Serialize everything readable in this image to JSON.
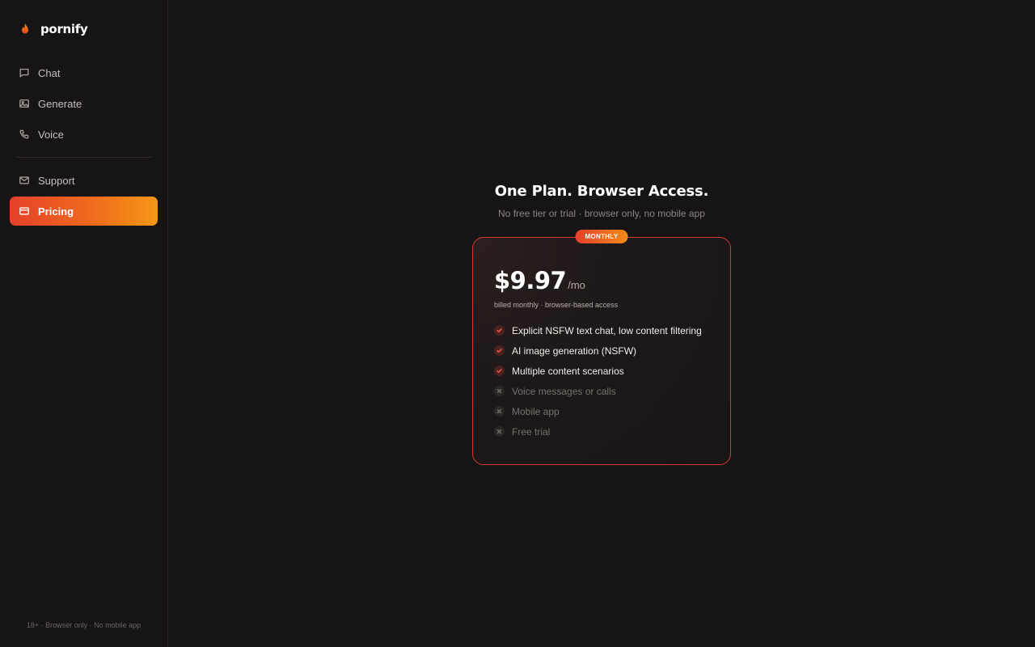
{
  "brand": {
    "name": "pornify",
    "logo_icon": "flame-icon"
  },
  "sidebar": {
    "primary": [
      {
        "label": "Chat",
        "icon": "chat-bubble-icon"
      },
      {
        "label": "Generate",
        "icon": "image-icon"
      },
      {
        "label": "Voice",
        "icon": "phone-icon"
      }
    ],
    "secondary": [
      {
        "label": "Support",
        "icon": "mail-icon"
      },
      {
        "label": "Pricing",
        "icon": "credit-card-icon",
        "active": true
      }
    ],
    "footer": "18+ · Browser only · No mobile app"
  },
  "pricing": {
    "title": "One Plan. Browser Access.",
    "subtitle": "No free tier or trial · browser only, no mobile app",
    "plan": {
      "badge": "MONTHLY",
      "price": "$9.97",
      "unit": "/mo",
      "billing": "billed monthly · browser-based access",
      "features": [
        {
          "label": "Explicit NSFW text chat, low content filtering",
          "included": true
        },
        {
          "label": "AI image generation (NSFW)",
          "included": true
        },
        {
          "label": "Multiple content scenarios",
          "included": true
        },
        {
          "label": "Voice messages or calls",
          "included": false
        },
        {
          "label": "Mobile app",
          "included": false
        },
        {
          "label": "Free trial",
          "included": false
        }
      ]
    }
  },
  "colors": {
    "background": "#161415",
    "accent_start": "#e6412a",
    "accent_end": "#f59715",
    "card_border": "#d43a30"
  }
}
